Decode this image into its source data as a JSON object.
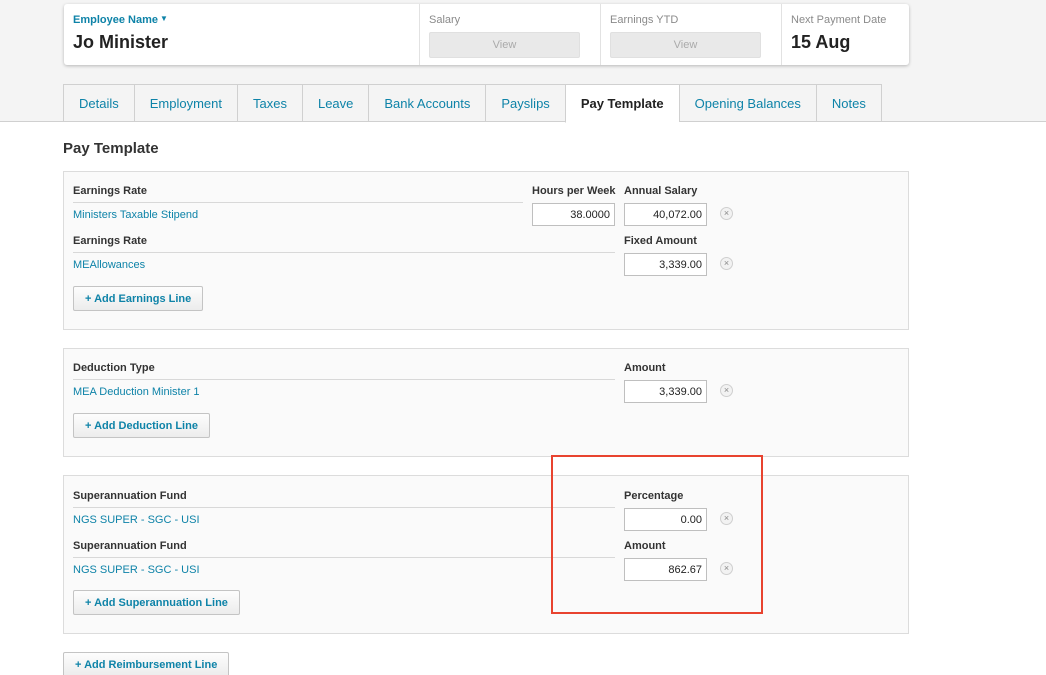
{
  "header": {
    "employee_name_label": "Employee Name",
    "employee_name": "Jo Minister",
    "salary_label": "Salary",
    "salary_view": "View",
    "earnings_ytd_label": "Earnings YTD",
    "earnings_ytd_view": "View",
    "next_payment_label": "Next Payment Date",
    "next_payment_value": "15 Aug"
  },
  "tabs": [
    {
      "label": "Details"
    },
    {
      "label": "Employment"
    },
    {
      "label": "Taxes"
    },
    {
      "label": "Leave"
    },
    {
      "label": "Bank Accounts"
    },
    {
      "label": "Payslips"
    },
    {
      "label": "Pay Template",
      "active": true
    },
    {
      "label": "Opening Balances"
    },
    {
      "label": "Notes"
    }
  ],
  "page_title": "Pay Template",
  "earnings": {
    "rows": [
      {
        "type_header": "Earnings Rate",
        "hours_header": "Hours per Week",
        "amount_header": "Annual Salary",
        "name": "Ministers Taxable Stipend",
        "hours": "38.0000",
        "amount": "40,072.00"
      },
      {
        "type_header": "Earnings Rate",
        "amount_header": "Fixed Amount",
        "name": "MEAllowances",
        "amount": "3,339.00"
      }
    ],
    "add_label": "+ Add Earnings Line"
  },
  "deductions": {
    "type_header": "Deduction Type",
    "amount_header": "Amount",
    "name": "MEA Deduction Minister 1",
    "amount": "3,339.00",
    "add_label": "+ Add Deduction Line"
  },
  "super": {
    "rows": [
      {
        "type_header": "Superannuation Fund",
        "amount_header": "Percentage",
        "name": "NGS SUPER - SGC - USI",
        "amount": "0.00"
      },
      {
        "type_header": "Superannuation Fund",
        "amount_header": "Amount",
        "name": "NGS SUPER - SGC - USI",
        "amount": "862.67"
      }
    ],
    "add_label": "+ Add Superannuation Line"
  },
  "reimbursement": {
    "add_label": "+ Add Reimbursement Line"
  },
  "remove_glyph": "×",
  "colors": {
    "link": "#0e83a8",
    "highlight": "#e8432f"
  }
}
